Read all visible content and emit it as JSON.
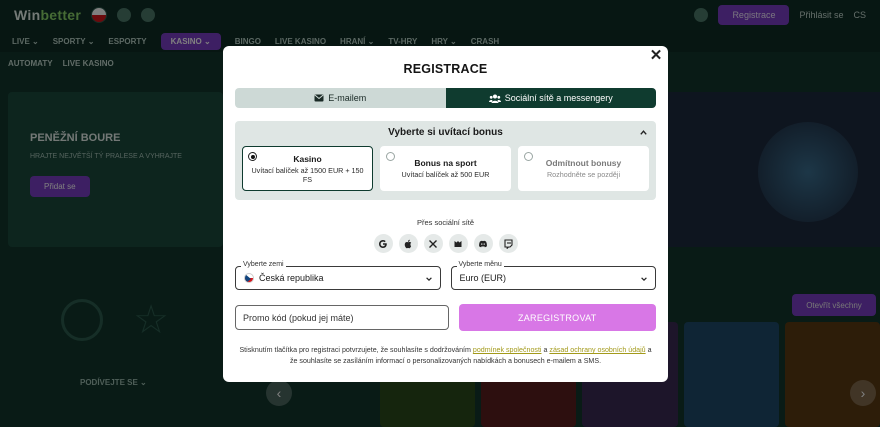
{
  "background": {
    "logo_main": "Win",
    "logo_accent": "better",
    "topbar_cta": "Registrace",
    "topbar_link": "Přihlásit se",
    "topbar_lang": "CS",
    "nav_items": [
      "LIVE ⌄",
      "SPORTY ⌄",
      "ESPORTY",
      "KASINO ⌄",
      "BINGO",
      "LIVE KASINO",
      "HRANÍ ⌄",
      "TV-HRY",
      "HRY ⌄",
      "CRASH"
    ],
    "nav_active_index": 3,
    "subnav": [
      "AUTOMATY",
      "LIVE KASINO"
    ],
    "hero_title": "PENĚŽNÍ BOURE",
    "hero_sub": "HRAJTE NEJVĚTŠÍ TÝ PRALESE A VYHRAJTE",
    "hero_btn": "Přidat se",
    "left_label": "PODÍVEJTE SE ⌄",
    "right_cta": "Otevřít všechny",
    "thumb_colors": [
      "#2a4a1a",
      "#5a1e1e",
      "#3b2a55",
      "#1e4a6a",
      "#5a3a12"
    ]
  },
  "modal": {
    "title": "REGISTRACE",
    "close_glyph": "✕",
    "tabs": [
      {
        "label": "E-mailem",
        "icon": "envelope-icon",
        "active": false
      },
      {
        "label": "Sociální sítě a messengery",
        "icon": "users-icon",
        "active": true
      }
    ],
    "bonus": {
      "title": "Vyberte si uvítací bonus",
      "options": [
        {
          "name": "Kasino",
          "desc": "Uvítací balíček až 1500 EUR + 150 FS",
          "selected": true
        },
        {
          "name": "Bonus na sport",
          "desc": "Uvítací balíček až 500 EUR",
          "selected": false
        },
        {
          "name": "Odmítnout bonusy",
          "desc": "Rozhodněte se později",
          "selected": false
        }
      ]
    },
    "social_label": "Přes sociální sítě",
    "social_icons": [
      "google-icon",
      "apple-icon",
      "x-icon",
      "mail-ru-icon",
      "discord-icon",
      "twitch-icon"
    ],
    "country": {
      "legend": "Vyberte zemi",
      "value": "Česká republika"
    },
    "currency": {
      "legend": "Vyberte měnu",
      "value": "Euro (EUR)"
    },
    "promo_placeholder": "Promo kód (pokud jej máte)",
    "register_label": "ZAREGISTROVAT",
    "register_color": "#d877e6",
    "accent_dark": "#0f3b2f",
    "terms": {
      "part1": "Stisknutím tlačítka pro registraci potvrzujete, že souhlasíte s dodržováním ",
      "link1": "podmínek společnosti",
      "part2": " a ",
      "link2": "zásad ochrany osobních údajů",
      "part3": " a že souhlasíte se zasíláním informací o personalizovaných nabídkách a bonusech e-mailem a SMS."
    }
  }
}
